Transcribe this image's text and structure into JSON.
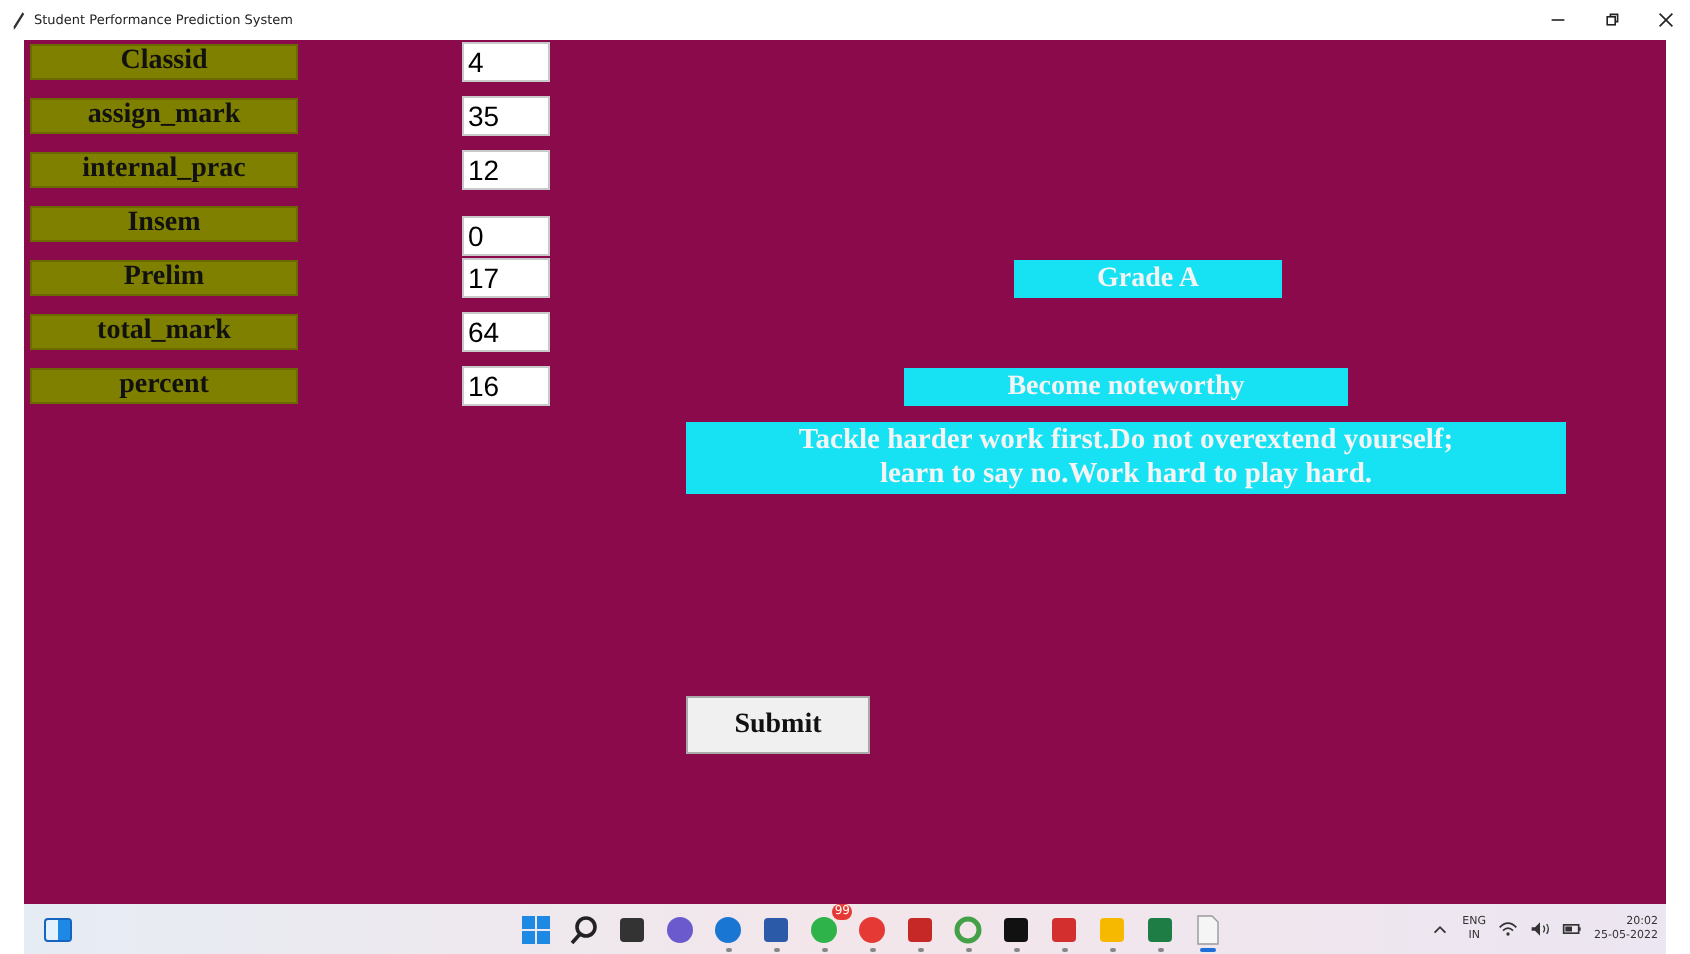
{
  "window": {
    "title": "Student Performance Prediction System"
  },
  "fields": [
    {
      "label": "Classid",
      "value": "4"
    },
    {
      "label": "assign_mark",
      "value": "35"
    },
    {
      "label": "internal_prac",
      "value": "12"
    },
    {
      "label": "Insem",
      "value": "0"
    },
    {
      "label": "Prelim",
      "value": "17"
    },
    {
      "label": "total_mark",
      "value": "64"
    },
    {
      "label": "percent",
      "value": "16"
    }
  ],
  "grade": "Grade A",
  "advice_title": "Become noteworthy",
  "advice": "Tackle harder work first.Do not overextend yourself;\nlearn to say no.Work hard to play hard.",
  "submit_button": "Submit",
  "taskbar": {
    "apps": [
      {
        "kind": "start",
        "color": "#1e88e5",
        "running": false,
        "active": false
      },
      {
        "kind": "search",
        "color": "#222222",
        "running": false,
        "active": false
      },
      {
        "kind": "tile",
        "color": "#333333",
        "running": false,
        "active": false
      },
      {
        "kind": "round",
        "color": "#6a5acd",
        "running": false,
        "active": false
      },
      {
        "kind": "round",
        "color": "#1976d2",
        "running": true,
        "active": false
      },
      {
        "kind": "tile",
        "color": "#2b5aa8",
        "running": true,
        "active": false
      },
      {
        "kind": "round",
        "color": "#2eb24a",
        "running": true,
        "active": false,
        "badge": "99"
      },
      {
        "kind": "round",
        "color": "#e53935",
        "running": true,
        "active": false
      },
      {
        "kind": "tile",
        "color": "#c62828",
        "running": true,
        "active": false
      },
      {
        "kind": "ring",
        "color": "#43a047",
        "running": true,
        "active": false
      },
      {
        "kind": "tile",
        "color": "#111111",
        "running": true,
        "active": false
      },
      {
        "kind": "tile",
        "color": "#d32f2f",
        "running": true,
        "active": false
      },
      {
        "kind": "tile",
        "color": "#f6b900",
        "running": true,
        "active": false
      },
      {
        "kind": "tile",
        "color": "#1e7d45",
        "running": true,
        "active": false
      },
      {
        "kind": "page",
        "color": "#f5f5f5",
        "running": true,
        "active": true
      }
    ],
    "language": "ENG",
    "region": "IN",
    "time": "20:02",
    "date": "25-05-2022"
  }
}
